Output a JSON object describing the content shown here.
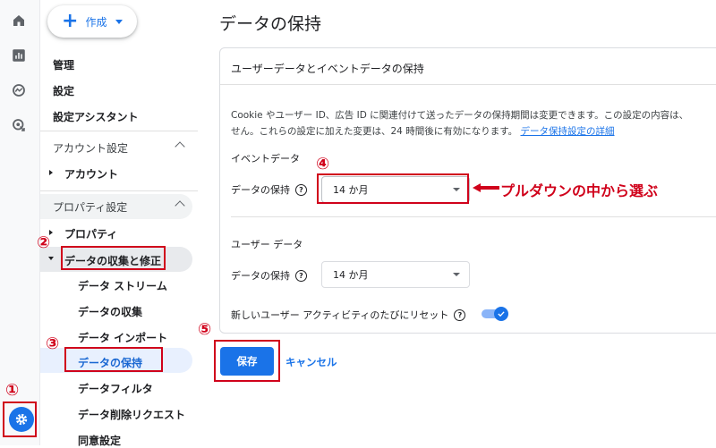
{
  "nav": {
    "create_label": "作成",
    "items": [
      "管理",
      "設定",
      "設定アシスタント"
    ],
    "account_section": "アカウント設定",
    "account_item": "アカウント",
    "property_section": "プロパティ設定",
    "property_item": "プロパティ",
    "data_collection": "データの収集と修正",
    "sub_items": [
      "データ ストリーム",
      "データの収集",
      "データ インポート",
      "データの保持",
      "データフィルタ",
      "データ削除リクエスト",
      "同意設定"
    ]
  },
  "main": {
    "title": "データの保持",
    "card_header": "ユーザーデータとイベントデータの保持",
    "desc_line1": "Cookie やユーザー ID、広告 ID に関連付けて送ったデータの保持期間は変更できます。この設定の内容は、",
    "desc_line2": "せん。これらの設定に加えた変更は、24 時間後に有効になります。",
    "desc_link": "データ保持設定の詳細",
    "event_section": "イベントデータ",
    "event_field_label": "データの保持",
    "event_value": "14 か月",
    "user_section": "ユーザー データ",
    "user_field_label": "データの保持",
    "user_value": "14 か月",
    "reset_label": "新しいユーザー アクティビティのたびにリセット",
    "save_label": "保存",
    "cancel_label": "キャンセル"
  },
  "annotations": {
    "step1": "①",
    "step2": "②",
    "step3": "③",
    "step4": "④",
    "step5": "⑤",
    "callout": "プルダウンの中から選ぶ"
  },
  "colors": {
    "accent": "#1a73e8",
    "annotation": "#d0021b"
  },
  "icons": [
    "home-icon",
    "reports-icon",
    "explore-icon",
    "advertising-icon",
    "settings-gear-icon"
  ]
}
